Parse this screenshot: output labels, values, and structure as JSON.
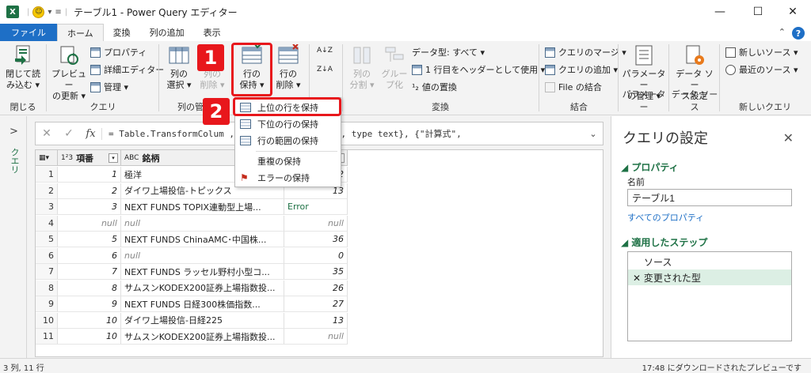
{
  "window": {
    "app_icon": "X",
    "title": "テーブル1 - Power Query エディター",
    "minimize": "—",
    "maximize": "☐",
    "close": "✕"
  },
  "tabs": [
    {
      "label": "ファイル"
    },
    {
      "label": "ホーム"
    },
    {
      "label": "変換"
    },
    {
      "label": "列の追加"
    },
    {
      "label": "表示"
    }
  ],
  "ribbon": {
    "close_group": {
      "btn": "閉じて読\nみ込む ▾",
      "label": "閉じる"
    },
    "query_group": {
      "refresh": "プレビュー\nの更新 ▾",
      "properties": "プロパティ",
      "advanced_editor": "詳細エディター",
      "manage": "管理 ▾",
      "label": "クエリ"
    },
    "column_group": {
      "select_cols": "列の\n選択 ▾",
      "remove_cols": "列の\n削除 ▾",
      "label": "列の管"
    },
    "rows_group": {
      "keep_rows": "行の\n保持 ▾",
      "remove_rows": "行の\n削除 ▾"
    },
    "sort_group": {
      "az": "A↓Z",
      "za": "Z↓A"
    },
    "transform_group": {
      "split": "列の\n分割 ▾",
      "group_by": "グルー\nプ化",
      "data_type": "データ型: すべて ▾",
      "first_row_header": "1 行目をヘッダーとして使用 ▾",
      "replace_values": "値の置換",
      "label": "変換"
    },
    "combine_group": {
      "merge": "クエリのマージ ▾",
      "append": "クエリの追加 ▾",
      "combine_files": "File の結合",
      "label": "結合"
    },
    "params_group": {
      "manage": "パラメーター\nの管理 ▾",
      "label": "パラメーター"
    },
    "datasource_group": {
      "settings": "データ ソー\nス設定",
      "label": "データ ソース"
    },
    "newquery_group": {
      "new_source": "新しいソース ▾",
      "recent_sources": "最近のソース ▾",
      "label": "新しいクエリ"
    }
  },
  "badges": {
    "one": "1",
    "two": "2"
  },
  "dropdown": {
    "items": [
      {
        "label": "上位の行を保持"
      },
      {
        "label": "下位の行の保持"
      },
      {
        "label": "行の範囲の保持"
      },
      {
        "label": "重複の保持"
      },
      {
        "label": "エラーの保持"
      }
    ]
  },
  "left_pane": {
    "arrow": ">",
    "label": "クエリ"
  },
  "formula_bar": {
    "cancel": "✕",
    "accept": "✓",
    "fx": "fx",
    "formula": "= Table.TransformColum                             , Int64.Type}, {\"銘柄\", type text}, {\"計算式\",",
    "expand": "⌄"
  },
  "grid": {
    "columns": [
      {
        "type": "1²3",
        "name": "項番"
      },
      {
        "type": "ABC",
        "name": "銘柄"
      },
      {
        "type": "",
        "name": ""
      }
    ],
    "rows": [
      {
        "n": "1",
        "a": "1",
        "b": "極洋",
        "c": "2"
      },
      {
        "n": "2",
        "a": "2",
        "b": "ダイワ上場投信-トピックス",
        "c": "13"
      },
      {
        "n": "3",
        "a": "3",
        "b": "NEXT FUNDS TOPIX連動型上場...",
        "c": "Error"
      },
      {
        "n": "4",
        "a": "null",
        "b": "null",
        "c": "null"
      },
      {
        "n": "5",
        "a": "5",
        "b": "NEXT FUNDS ChinaAMC･中国株...",
        "c": "36"
      },
      {
        "n": "6",
        "a": "6",
        "b": "null",
        "c": "0"
      },
      {
        "n": "7",
        "a": "7",
        "b": "NEXT FUNDS ラッセル野村小型コ...",
        "c": "35"
      },
      {
        "n": "8",
        "a": "8",
        "b": "サムスンKODEX200証券上場指数投...",
        "c": "26"
      },
      {
        "n": "9",
        "a": "9",
        "b": "NEXT FUNDS 日経300株価指数...",
        "c": "27"
      },
      {
        "n": "10",
        "a": "10",
        "b": "ダイワ上場投信-日経225",
        "c": "13"
      },
      {
        "n": "11",
        "a": "10",
        "b": "サムスンKODEX200証券上場指数投...",
        "c": "null"
      }
    ]
  },
  "query_settings": {
    "title": "クエリの設定",
    "close": "✕",
    "properties_header": "◢ プロパティ",
    "name_label": "名前",
    "name_value": "テーブル1",
    "all_properties": "すべてのプロパティ",
    "steps_header": "◢ 適用したステップ",
    "steps": [
      {
        "label": "ソース"
      },
      {
        "label": "✕ 変更された型"
      }
    ]
  },
  "status": {
    "left": "3 列, 11 行",
    "right": "17:48 にダウンロードされたプレビューです"
  },
  "colors": {
    "accent": "#1e6fc6",
    "highlight": "#e8171c",
    "green": "#1e7145"
  }
}
